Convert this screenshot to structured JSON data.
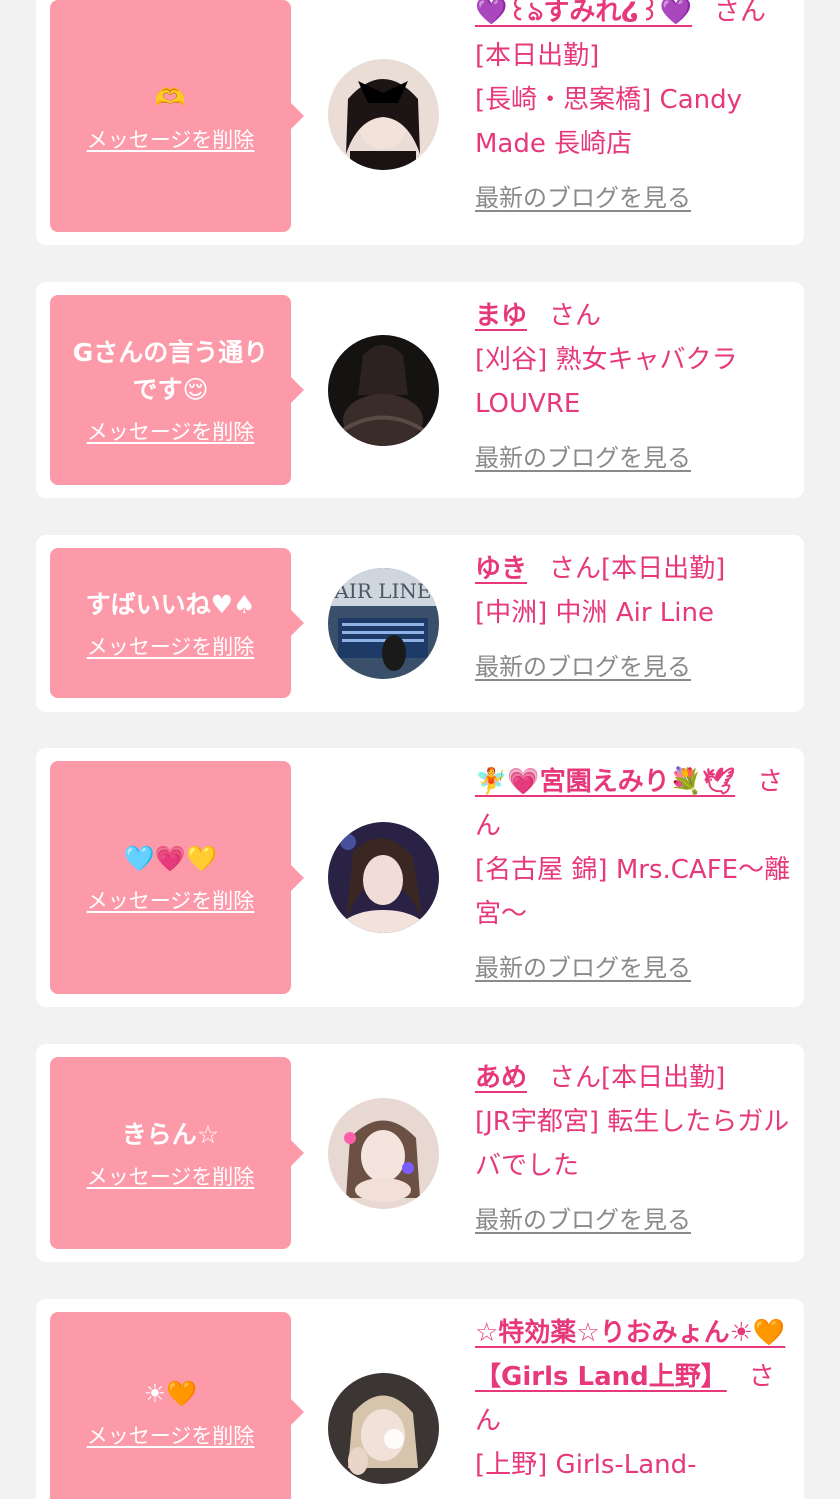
{
  "delete_label": "メッセージを削除",
  "blog_label": "最新のブログを見る",
  "honorific": "さん",
  "colors": {
    "bubble": "#fd9aa9",
    "accent": "#e6387a",
    "link_gray": "#8a8a8a",
    "background": "#f2f2f2"
  },
  "messages": [
    {
      "message": "🫶",
      "name": "💜꒰ঌすみれ໒꒱💜",
      "status": "[本日出勤]",
      "shop": "[長崎・思案橋] Candy Made 長崎店"
    },
    {
      "message": "Gさんの言う通りです😌",
      "name": "まゆ",
      "status": "",
      "shop": "[刈谷] 熟女キャバクラ LOUVRE"
    },
    {
      "message": "すばいいね♥♠",
      "name": "ゆき",
      "status": "[本日出勤]",
      "shop": "[中洲] 中洲 Air Line"
    },
    {
      "message": "🩵💗💛",
      "name": "🧚💗宮園えみり💐🕊",
      "status": "",
      "shop": "[名古屋 錦] Mrs.CAFE～離宮～"
    },
    {
      "message": "きらん☆",
      "name": "あめ",
      "status": "[本日出勤]",
      "shop": "[JR宇都宮] 転生したらガルバでした"
    },
    {
      "message": "☀🧡",
      "name": "☆特効薬☆りおみょん☀🧡【Girls Land上野】",
      "status": "",
      "shop": "[上野] Girls-Land-"
    }
  ]
}
